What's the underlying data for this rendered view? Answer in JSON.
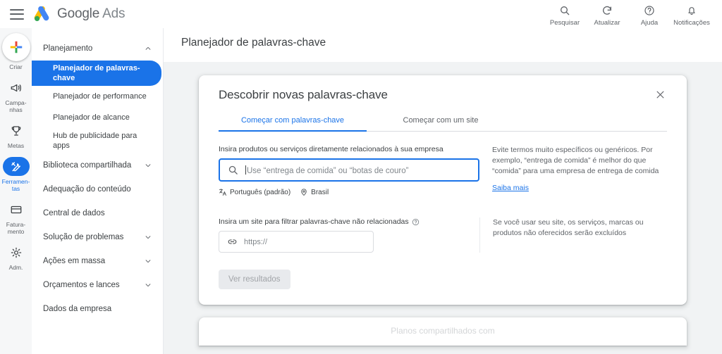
{
  "topbar": {
    "menu_icon": "hamburger-icon",
    "brand_google": "Google",
    "brand_ads": "Ads",
    "actions": [
      {
        "icon": "search-icon",
        "label": "Pesquisar"
      },
      {
        "icon": "refresh-icon",
        "label": "Atualizar"
      },
      {
        "icon": "help-icon",
        "label": "Ajuda"
      },
      {
        "icon": "bell-icon",
        "label": "Notificações"
      }
    ]
  },
  "rail": {
    "items": [
      {
        "icon": "plus-icon",
        "label": "Criar",
        "active": false,
        "type": "create"
      },
      {
        "icon": "megaphone-icon",
        "label": "Campa-\nnhas",
        "label_l1": "Campa-",
        "label_l2": "nhas",
        "active": false
      },
      {
        "icon": "trophy-icon",
        "label": "Metas",
        "label_l1": "Metas",
        "label_l2": "",
        "active": false
      },
      {
        "icon": "tools-icon",
        "label": "Ferramentas",
        "label_l1": "Ferramen-",
        "label_l2": "tas",
        "active": true
      },
      {
        "icon": "billing-icon",
        "label": "Faturamento",
        "label_l1": "Fatura-",
        "label_l2": "mento",
        "active": false
      },
      {
        "icon": "gear-icon",
        "label": "Adm.",
        "label_l1": "Adm.",
        "label_l2": "",
        "active": false
      }
    ]
  },
  "sidebar": {
    "groups": [
      {
        "label": "Planejamento",
        "expanded": true,
        "chevron": "chevron-up-icon",
        "items": [
          {
            "label": "Planejador de palavras-chave",
            "selected": true
          },
          {
            "label": "Planejador de performance",
            "selected": false
          },
          {
            "label": "Planejador de alcance",
            "selected": false
          },
          {
            "label": "Hub de publicidade para apps",
            "selected": false
          }
        ]
      }
    ],
    "collapsed": [
      {
        "label": "Biblioteca compartilhada",
        "chevron": "chevron-down-icon",
        "has_chevron": true
      },
      {
        "label": "Adequação do conteúdo",
        "has_chevron": false
      },
      {
        "label": "Central de dados",
        "has_chevron": false
      },
      {
        "label": "Solução de problemas",
        "chevron": "chevron-down-icon",
        "has_chevron": true
      },
      {
        "label": "Ações em massa",
        "chevron": "chevron-down-icon",
        "has_chevron": true
      },
      {
        "label": "Orçamentos e lances",
        "chevron": "chevron-down-icon",
        "has_chevron": true
      },
      {
        "label": "Dados da empresa",
        "has_chevron": false
      }
    ]
  },
  "main": {
    "page_title": "Planejador de palavras-chave"
  },
  "modal": {
    "title": "Descobrir novas palavras-chave",
    "close_icon": "close-icon",
    "tabs": [
      {
        "label": "Começar com palavras-chave",
        "active": true
      },
      {
        "label": "Começar com um site",
        "active": false
      }
    ],
    "keyword_section": {
      "label": "Insira produtos ou serviços diretamente relacionados à sua empresa",
      "search_icon": "search-icon",
      "input_value": "",
      "placeholder": "Use “entrega de comida” ou “botas de couro”",
      "chips": [
        {
          "icon": "translate-icon",
          "label": "Português (padrão)"
        },
        {
          "icon": "location-pin-icon",
          "label": "Brasil"
        }
      ],
      "help_text": "Evite termos muito específicos ou genéricos. Por exemplo, “entrega de comida” é melhor do que “comida” para uma empresa de entrega de comida",
      "help_link": "Saiba mais"
    },
    "site_section": {
      "label": "Insira um site para filtrar palavras-chave não relacionadas",
      "info_icon": "help-circle-icon",
      "link_icon": "link-icon",
      "input_value": "",
      "placeholder": "https://",
      "help_text": "Se você usar seu site, os serviços, marcas ou produtos não oferecidos serão excluídos"
    },
    "submit_button": {
      "label": "Ver resultados",
      "disabled": true
    }
  },
  "lower_card": {
    "title": "Planos compartilhados com"
  },
  "colors": {
    "accent_blue": "#1a73e8",
    "text_primary": "#3c4043",
    "text_secondary": "#5f6368",
    "canvas": "#f1f3f4",
    "rail_bg": "#f6f7f8",
    "border": "#dadce0"
  }
}
